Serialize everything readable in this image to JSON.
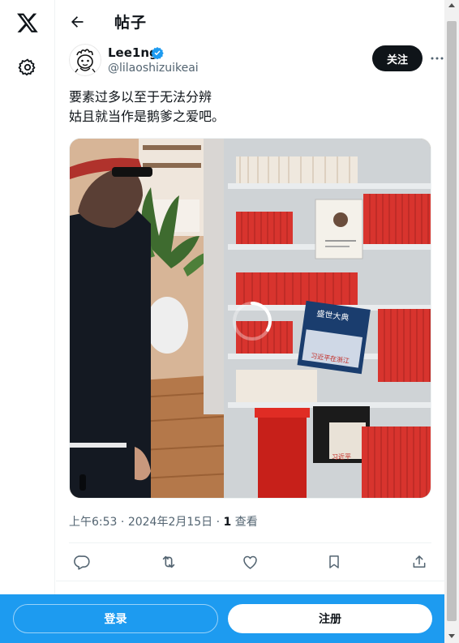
{
  "header": {
    "title": "帖子"
  },
  "author": {
    "name": "Lee1ng",
    "handle": "@lilaoshizuikeai",
    "verified": true
  },
  "buttons": {
    "follow": "关注",
    "login": "登录",
    "signup": "注册"
  },
  "post": {
    "lines": [
      "要素过多以至于无法分辨",
      "姑且就当作是鹅爹之爱吧。"
    ],
    "time": "上午6:53",
    "date": "2024年2月15日",
    "separator": "·",
    "views_count": "1",
    "views_label": "查看"
  },
  "media": {
    "book_cover_lines": [
      "盛世大典",
      "习近平在浙江"
    ],
    "photo_caption": "习近平"
  },
  "colors": {
    "accent": "#1d9bf0",
    "text": "#0f1419",
    "muted": "#536471",
    "follow_bg": "#0f1419"
  },
  "icons": {
    "logo": "x-logo-icon",
    "settings": "gear-icon",
    "back": "arrow-left-icon",
    "more": "more-horizontal-icon",
    "reply": "reply-icon",
    "repost": "repost-icon",
    "like": "heart-icon",
    "bookmark": "bookmark-icon",
    "share": "share-icon"
  }
}
